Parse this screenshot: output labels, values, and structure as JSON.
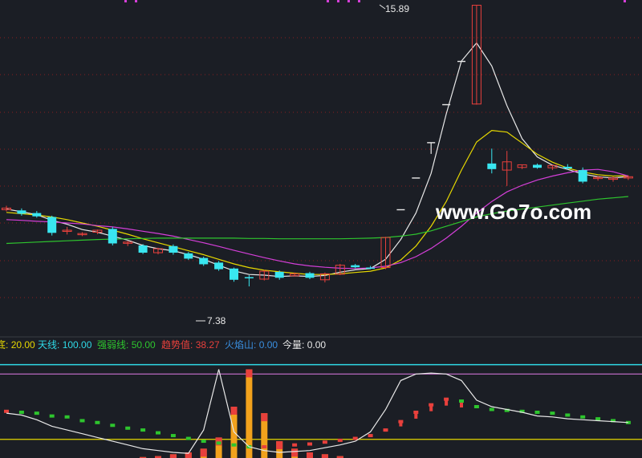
{
  "watermark": "www.Go7o.com",
  "colors": {
    "background": "#1b1e25",
    "grid": "#8a1f1f",
    "up_candle": "#e8403c",
    "down_candle": "#39e6f0",
    "ma_white": "#e8e8e8",
    "ma_yellow": "#e6d800",
    "ma_magenta": "#d43fd8",
    "ma_green": "#2ec52e",
    "ind_bottom": "#e6d800",
    "ind_top": "#2fd9e6",
    "ind_strong": "#e27ae6",
    "ind_trend": "#e8403c",
    "ind_fire": "#3a8fe0",
    "ind_volume": "#e8e8e8",
    "trend_up_dot": "#e8403c",
    "trend_down_dot": "#2ec52e"
  },
  "indicator_labels": [
    {
      "key": "bottom",
      "label": "底",
      "value": "20.00"
    },
    {
      "key": "top",
      "label": "天线",
      "value": "100.00"
    },
    {
      "key": "strong",
      "label": "强弱线",
      "value": "50.00"
    },
    {
      "key": "trend",
      "label": "趋势值",
      "value": "38.27"
    },
    {
      "key": "fire",
      "label": "火焰山",
      "value": "0.00"
    },
    {
      "key": "volume",
      "label": "今量",
      "value": "0.00"
    }
  ],
  "chart_data": [
    {
      "type": "candlestick",
      "title": "",
      "ylim": [
        5.9,
        16.0
      ],
      "candles": [
        {
          "o": 9.7,
          "h": 9.82,
          "c": 9.75,
          "l": 9.65
        },
        {
          "o": 9.68,
          "h": 9.74,
          "c": 9.58,
          "l": 9.52
        },
        {
          "o": 9.6,
          "h": 9.66,
          "c": 9.5,
          "l": 9.46
        },
        {
          "o": 9.48,
          "h": 9.52,
          "c": 9.0,
          "l": 8.92
        },
        {
          "o": 9.05,
          "h": 9.18,
          "c": 9.08,
          "l": 8.95
        },
        {
          "o": 8.96,
          "h": 9.02,
          "c": 8.98,
          "l": 8.9
        },
        {
          "o": 9.02,
          "h": 9.1,
          "c": 9.08,
          "l": 8.96
        },
        {
          "o": 9.12,
          "h": 9.18,
          "c": 8.68,
          "l": 8.62
        },
        {
          "o": 8.7,
          "h": 8.75,
          "c": 8.72,
          "l": 8.6
        },
        {
          "o": 8.62,
          "h": 8.66,
          "c": 8.4,
          "l": 8.36
        },
        {
          "o": 8.4,
          "h": 8.55,
          "c": 8.52,
          "l": 8.35
        },
        {
          "o": 8.6,
          "h": 8.65,
          "c": 8.4,
          "l": 8.34
        },
        {
          "o": 8.38,
          "h": 8.42,
          "c": 8.22,
          "l": 8.18
        },
        {
          "o": 8.24,
          "h": 8.28,
          "c": 8.05,
          "l": 8.0
        },
        {
          "o": 8.1,
          "h": 8.15,
          "c": 7.9,
          "l": 7.85
        },
        {
          "o": 7.92,
          "h": 7.95,
          "c": 7.58,
          "l": 7.52
        },
        {
          "o": 7.66,
          "h": 7.72,
          "c": 7.64,
          "l": 7.38
        },
        {
          "o": 7.6,
          "h": 7.88,
          "c": 7.84,
          "l": 7.56
        },
        {
          "o": 7.82,
          "h": 7.86,
          "c": 7.64,
          "l": 7.58
        },
        {
          "o": 7.7,
          "h": 7.8,
          "c": 7.76,
          "l": 7.68
        },
        {
          "o": 7.78,
          "h": 7.82,
          "c": 7.64,
          "l": 7.6
        },
        {
          "o": 7.58,
          "h": 7.8,
          "c": 7.76,
          "l": 7.5
        },
        {
          "o": 7.75,
          "h": 8.06,
          "c": 8.02,
          "l": 7.72
        },
        {
          "o": 8.02,
          "h": 8.06,
          "c": 7.96,
          "l": 7.92
        },
        {
          "o": 7.95,
          "h": 8.0,
          "c": 7.93,
          "l": 7.9
        },
        {
          "o": 7.95,
          "h": 8.88,
          "c": 8.86,
          "l": 7.9
        },
        {
          "o": null,
          "h": null,
          "c": null,
          "l": null,
          "note": "limit-up dash 9.70"
        },
        {
          "o": null,
          "h": null,
          "c": null,
          "l": null,
          "note": "limit-up dash 10.66"
        },
        {
          "o": null,
          "h": null,
          "c": null,
          "l": null,
          "note": "limit-up T 11.73"
        },
        {
          "o": null,
          "h": null,
          "c": null,
          "l": null,
          "note": "limit-up dash 12.88"
        },
        {
          "o": null,
          "h": null,
          "c": null,
          "l": null,
          "note": "limit-up dash 14.19"
        },
        {
          "o": 12.9,
          "h": 15.89,
          "c": 15.89,
          "l": 12.88
        },
        {
          "o": 11.1,
          "h": 11.55,
          "c": 10.93,
          "l": 10.8
        },
        {
          "o": 10.9,
          "h": 11.48,
          "c": 11.15,
          "l": 10.42
        },
        {
          "o": 10.98,
          "h": 11.06,
          "c": 11.06,
          "l": 10.93
        },
        {
          "o": 11.06,
          "h": 11.1,
          "c": 10.97,
          "l": 10.94
        },
        {
          "o": 10.97,
          "h": 11.03,
          "c": 11.04,
          "l": 10.9
        },
        {
          "o": 11.0,
          "h": 11.08,
          "c": 10.95,
          "l": 10.92
        },
        {
          "o": 10.9,
          "h": 10.98,
          "c": 10.55,
          "l": 10.5
        },
        {
          "o": 10.65,
          "h": 10.72,
          "c": 10.68,
          "l": 10.58
        },
        {
          "o": 10.62,
          "h": 10.7,
          "c": 10.66,
          "l": 10.55
        },
        {
          "o": 10.66,
          "h": 10.74,
          "c": 10.7,
          "l": 10.6
        }
      ],
      "annotations": [
        {
          "text": "15.89",
          "kind": "high"
        },
        {
          "text": "7.38",
          "kind": "low"
        }
      ],
      "series": [
        {
          "name": "",
          "color_key": "ma_white",
          "values": [
            9.72,
            9.64,
            9.55,
            9.38,
            9.26,
            9.1,
            9.02,
            8.9,
            8.78,
            8.62,
            8.52,
            8.46,
            8.34,
            8.2,
            8.02,
            7.85,
            7.74,
            7.72,
            7.68,
            7.7,
            7.68,
            7.71,
            7.81,
            7.88,
            7.92,
            8.2,
            8.8,
            9.6,
            10.8,
            12.6,
            14.2,
            14.75,
            14.05,
            12.85,
            11.85,
            11.3,
            11.05,
            10.92,
            10.78,
            10.7,
            10.66,
            10.7
          ]
        },
        {
          "name": "",
          "color_key": "ma_yellow",
          "values": [
            9.62,
            9.58,
            9.54,
            9.48,
            9.4,
            9.3,
            9.2,
            9.08,
            8.96,
            8.82,
            8.7,
            8.58,
            8.46,
            8.34,
            8.2,
            8.06,
            7.95,
            7.87,
            7.82,
            7.78,
            7.74,
            7.74,
            7.76,
            7.8,
            7.84,
            7.94,
            8.18,
            8.6,
            9.2,
            9.95,
            10.9,
            11.75,
            12.1,
            12.05,
            11.72,
            11.38,
            11.14,
            10.96,
            10.84,
            10.76,
            10.72,
            10.73
          ]
        },
        {
          "name": "",
          "color_key": "ma_magenta",
          "values": [
            9.4,
            9.38,
            9.35,
            9.33,
            9.3,
            9.27,
            9.22,
            9.18,
            9.12,
            9.05,
            8.98,
            8.9,
            8.8,
            8.7,
            8.59,
            8.47,
            8.36,
            8.25,
            8.15,
            8.06,
            8.0,
            7.96,
            7.93,
            7.92,
            7.94,
            7.99,
            8.1,
            8.28,
            8.53,
            8.84,
            9.2,
            9.6,
            9.95,
            10.24,
            10.44,
            10.6,
            10.72,
            10.82,
            10.9,
            10.92,
            10.85,
            10.72
          ]
        },
        {
          "name": "",
          "color_key": "ma_green",
          "values": [
            8.68,
            8.7,
            8.72,
            8.74,
            8.76,
            8.78,
            8.8,
            8.81,
            8.82,
            8.83,
            8.84,
            8.84,
            8.84,
            8.84,
            8.84,
            8.84,
            8.83,
            8.83,
            8.82,
            8.82,
            8.82,
            8.82,
            8.82,
            8.83,
            8.84,
            8.86,
            8.9,
            8.96,
            9.06,
            9.2,
            9.34,
            9.48,
            9.58,
            9.66,
            9.72,
            9.78,
            9.84,
            9.9,
            9.96,
            10.02,
            10.06,
            10.1
          ]
        }
      ]
    },
    {
      "type": "indicator",
      "ylim": [
        0,
        110
      ],
      "bottom_line": 20,
      "top_line": 100,
      "strong_line": 50,
      "trend": [
        50,
        49,
        48,
        45,
        44,
        40,
        38,
        35,
        32,
        30,
        27,
        24,
        21,
        18,
        16,
        14,
        12,
        12,
        13,
        14,
        15,
        17,
        19,
        21,
        24,
        30,
        39,
        49,
        57,
        63,
        61,
        55,
        52,
        51,
        50,
        49,
        48,
        46,
        44,
        42,
        40,
        38
      ],
      "white_line": [
        48,
        46,
        41,
        34,
        30,
        26,
        22,
        18,
        14,
        10,
        8,
        6,
        5,
        30,
        95,
        28,
        12,
        8,
        6,
        7,
        8,
        11,
        14,
        18,
        28,
        52,
        83,
        90,
        91,
        90,
        83,
        62,
        55,
        52,
        49,
        45,
        44,
        42,
        41,
        40,
        39,
        38
      ],
      "fire_bars": [
        0,
        0,
        0,
        0,
        0,
        0,
        0,
        0,
        0,
        1,
        2,
        4,
        6,
        10,
        22,
        55,
        95,
        48,
        18,
        10,
        6,
        4,
        2,
        0,
        0,
        0,
        0,
        0,
        0,
        0,
        0,
        0,
        0,
        0,
        0,
        0,
        0,
        0,
        0,
        0,
        0,
        0
      ],
      "red_bars": [
        0,
        0,
        0,
        0,
        0,
        0,
        0,
        0,
        0,
        0,
        0,
        0,
        0,
        0,
        0,
        0,
        0,
        0,
        0,
        0,
        0,
        0,
        0,
        0,
        0,
        2,
        6,
        10,
        15,
        20,
        22,
        0,
        0,
        0,
        0,
        0,
        0,
        0,
        0,
        0,
        0,
        0
      ]
    }
  ]
}
